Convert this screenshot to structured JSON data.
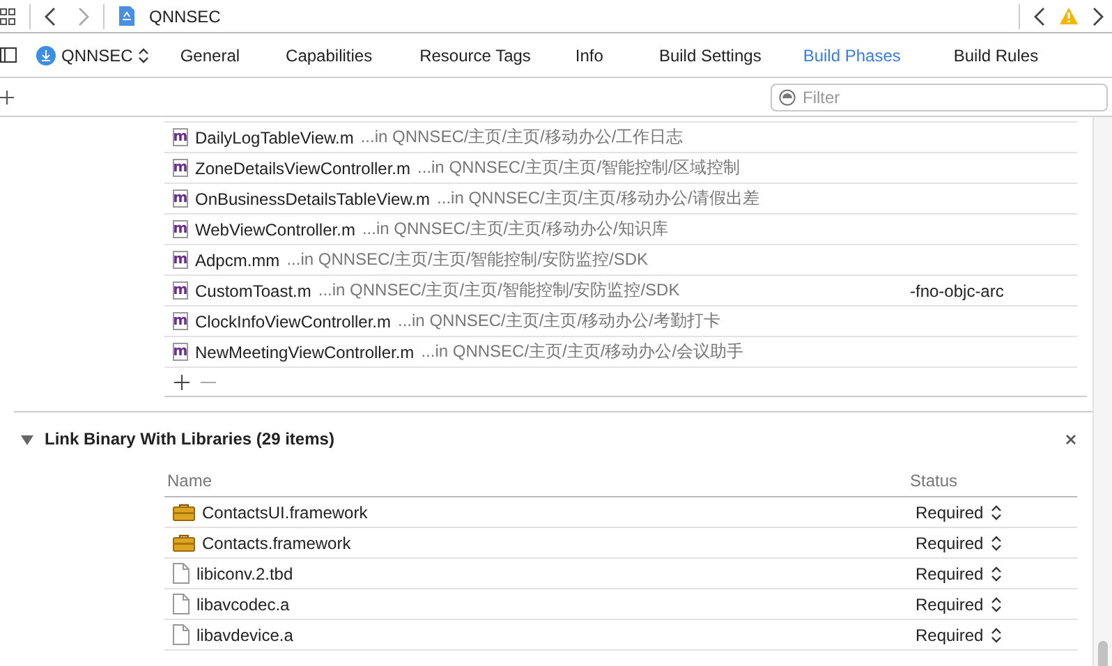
{
  "toolbar": {
    "title": "QNNSEC",
    "issues_warning": true
  },
  "target": {
    "name": "QNNSEC"
  },
  "tabs": [
    {
      "label": "General",
      "selected": false
    },
    {
      "label": "Capabilities",
      "selected": false
    },
    {
      "label": "Resource Tags",
      "selected": false
    },
    {
      "label": "Info",
      "selected": false
    },
    {
      "label": "Build Settings",
      "selected": false
    },
    {
      "label": "Build Phases",
      "selected": true
    },
    {
      "label": "Build Rules",
      "selected": false
    }
  ],
  "filter": {
    "placeholder": "Filter"
  },
  "compile_sources": {
    "rows": [
      {
        "icon_letter": "m",
        "file": "DailyLogTableView.m",
        "location": "...in QNNSEC/主页/主页/移动办公/工作日志",
        "flags": ""
      },
      {
        "icon_letter": "m",
        "file": "ZoneDetailsViewController.m",
        "location": "...in QNNSEC/主页/主页/智能控制/区域控制",
        "flags": ""
      },
      {
        "icon_letter": "m",
        "file": "OnBusinessDetailsTableView.m",
        "location": "...in QNNSEC/主页/主页/移动办公/请假出差",
        "flags": ""
      },
      {
        "icon_letter": "m",
        "file": "WebViewController.m",
        "location": "...in QNNSEC/主页/主页/移动办公/知识库",
        "flags": ""
      },
      {
        "icon_letter": "m",
        "file": "Adpcm.mm",
        "location": "...in QNNSEC/主页/主页/智能控制/安防监控/SDK",
        "flags": ""
      },
      {
        "icon_letter": "m",
        "file": "CustomToast.m",
        "location": "...in QNNSEC/主页/主页/智能控制/安防监控/SDK",
        "flags": "-fno-objc-arc"
      },
      {
        "icon_letter": "m",
        "file": "ClockInfoViewController.m",
        "location": "...in QNNSEC/主页/主页/移动办公/考勤打卡",
        "flags": ""
      },
      {
        "icon_letter": "m",
        "file": "NewMeetingViewController.m",
        "location": "...in QNNSEC/主页/主页/移动办公/会议助手",
        "flags": ""
      }
    ]
  },
  "link_libraries": {
    "title": "Link Binary With Libraries (29 items)",
    "expanded": true,
    "columns": [
      "Name",
      "Status"
    ],
    "rows": [
      {
        "kind": "framework",
        "name": "ContactsUI.framework",
        "status": "Required"
      },
      {
        "kind": "framework",
        "name": "Contacts.framework",
        "status": "Required"
      },
      {
        "kind": "file",
        "name": "libiconv.2.tbd",
        "status": "Required"
      },
      {
        "kind": "file",
        "name": "libavcodec.a",
        "status": "Required"
      },
      {
        "kind": "file",
        "name": "libavdevice.a",
        "status": "Required"
      }
    ]
  }
}
